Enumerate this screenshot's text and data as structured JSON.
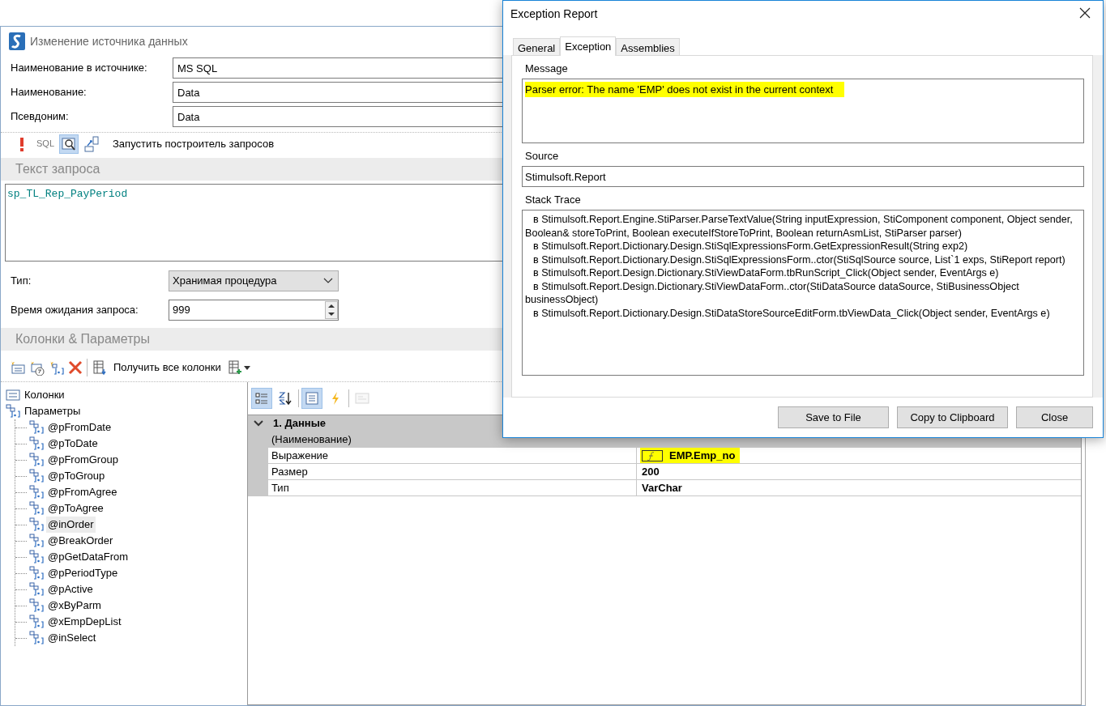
{
  "main_window": {
    "title": "Изменение источника данных",
    "fields": [
      {
        "label": "Наименование в источнике:",
        "value": "MS SQL"
      },
      {
        "label": "Наименование:",
        "value": "Data"
      },
      {
        "label": "Псевдоним:",
        "value": "Data"
      }
    ],
    "query_toolbar": {
      "tools": [
        {
          "kind": "warning",
          "selected": false
        },
        {
          "kind": "sql",
          "text": "SQL",
          "selected": false
        },
        {
          "kind": "view",
          "selected": true
        },
        {
          "kind": "builder",
          "selected": false
        }
      ],
      "run_builder_label": "Запустить построитель запросов"
    },
    "query_section": {
      "title": "Текст запроса",
      "query": "sp_TL_Rep_PayPeriod"
    },
    "type": {
      "label": "Тип:",
      "value": "Хранимая процедура"
    },
    "timeout": {
      "label": "Время ожидания запроса:",
      "value": "999"
    },
    "columns_section": {
      "title": "Колонки & Параметры"
    },
    "columns_toolbar": [
      {
        "kind": "new-column"
      },
      {
        "kind": "new-calc-column"
      },
      {
        "kind": "new-parameter"
      },
      {
        "kind": "delete"
      },
      {
        "kind": "retrieve",
        "text": "Получить все колонки"
      },
      {
        "kind": "dropdown"
      }
    ],
    "tree": [
      {
        "label": "Колонки",
        "kind": "columns",
        "selected": false
      },
      {
        "label": "Параметры",
        "kind": "parameters",
        "selected": false,
        "children": [
          {
            "label": "@pFromDate",
            "selected": false
          },
          {
            "label": "@pToDate",
            "selected": false
          },
          {
            "label": "@pFromGroup",
            "selected": false
          },
          {
            "label": "@pToGroup",
            "selected": false
          },
          {
            "label": "@pFromAgree",
            "selected": false
          },
          {
            "label": "@pToAgree",
            "selected": false
          },
          {
            "label": "@inOrder",
            "selected": true
          },
          {
            "label": "@BreakOrder",
            "selected": false
          },
          {
            "label": "@pGetDataFrom",
            "selected": false
          },
          {
            "label": "@pPeriodType",
            "selected": false
          },
          {
            "label": "@pActive",
            "selected": false
          },
          {
            "label": "@xByParm",
            "selected": false
          },
          {
            "label": "@xEmpDepList",
            "selected": false
          },
          {
            "label": "@inSelect",
            "selected": false
          }
        ]
      }
    ],
    "property_grid": {
      "toolbar": [
        {
          "kind": "categorized",
          "selected": true,
          "disabled": false
        },
        {
          "kind": "alphabetical",
          "selected": false,
          "disabled": false
        },
        {
          "kind": "properties",
          "selected": true,
          "disabled": false
        },
        {
          "kind": "events",
          "selected": false,
          "disabled": false
        },
        {
          "kind": "pages",
          "selected": false,
          "disabled": true
        }
      ],
      "category": {
        "title": "1. Данные",
        "expanded": true
      },
      "rows": [
        {
          "name": "(Наименование)",
          "selected": true
        },
        {
          "name": "Выражение",
          "value": "EMP.Emp_no",
          "selected": false,
          "expression": true,
          "highlighted": true
        },
        {
          "name": "Размер",
          "value": "200",
          "selected": false,
          "expression": false,
          "highlighted": false
        },
        {
          "name": "Тип",
          "value": "VarChar",
          "selected": false,
          "expression": false,
          "highlighted": false
        }
      ]
    }
  },
  "dialog": {
    "title": "Exception Report",
    "tabs": [
      {
        "label": "General",
        "selected": false
      },
      {
        "label": "Exception",
        "selected": true
      },
      {
        "label": "Assemblies",
        "selected": false
      }
    ],
    "message": {
      "label": "Message",
      "text": "Parser error: The name 'EMP' does not exist in the current context",
      "highlighted": true
    },
    "source": {
      "label": "Source",
      "text": "Stimulsoft.Report"
    },
    "stack_trace": {
      "label": "Stack Trace",
      "lines": [
        "в Stimulsoft.Report.Engine.StiParser.ParseTextValue(String inputExpression, StiComponent component, Object sender, Boolean& storeToPrint, Boolean executeIfStoreToPrint, Boolean returnAsmList, StiParser parser)",
        "в Stimulsoft.Report.Dictionary.Design.StiSqlExpressionsForm.GetExpressionResult(String exp2)",
        "в Stimulsoft.Report.Dictionary.Design.StiSqlExpressionsForm..ctor(StiSqlSource source, List`1 exps, StiReport report)",
        "в Stimulsoft.Report.Design.Dictionary.StiViewDataForm.tbRunScript_Click(Object sender, EventArgs e)",
        "в Stimulsoft.Report.Design.Dictionary.StiViewDataForm..ctor(StiDataSource dataSource, StiBusinessObject businessObject)",
        "в Stimulsoft.Report.Dictionary.Design.StiDataStoreSourceEditForm.tbViewData_Click(Object sender, EventArgs e)"
      ]
    },
    "buttons": [
      "Save to File",
      "Copy to Clipboard",
      "Close"
    ]
  }
}
